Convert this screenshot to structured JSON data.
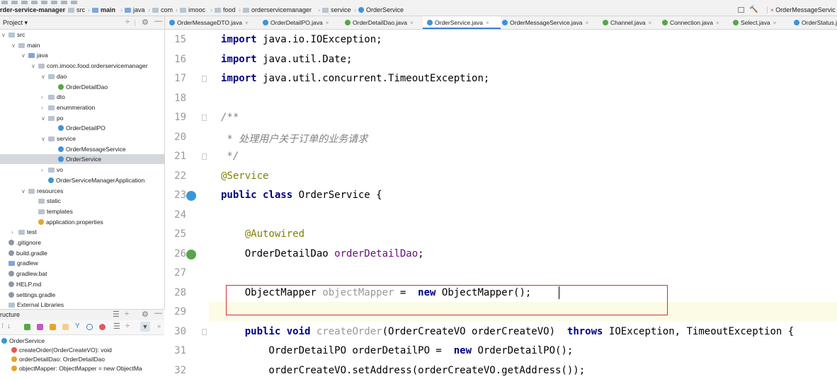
{
  "breadcrumb": [
    "rder-service-manager",
    "src",
    "main",
    "java",
    "com",
    "imooc",
    "food",
    "orderservicemanager",
    "service",
    "OrderService"
  ],
  "right_tab": "OrderMessageServic",
  "project_panel": {
    "title": "Project"
  },
  "tabs": [
    {
      "label": "OrderMessageDTO.java",
      "color": "#3d94d6"
    },
    {
      "label": "OrderDetailPO.java",
      "color": "#3d94d6"
    },
    {
      "label": "OrderDetailDao.java",
      "color": "#57a64a"
    },
    {
      "label": "OrderService.java",
      "color": "#3d94d6",
      "active": true
    },
    {
      "label": "OrderMessageService.java",
      "color": "#3d94d6"
    },
    {
      "label": "Channel.java",
      "color": "#57a64a"
    },
    {
      "label": "Connection.java",
      "color": "#57a64a"
    },
    {
      "label": "Select.java",
      "color": "#57a64a"
    },
    {
      "label": "OrderStatus.ja",
      "color": "#3d94d6"
    }
  ],
  "tree": [
    {
      "label": "src",
      "indent": 0,
      "chev": "v",
      "icon": "folder"
    },
    {
      "label": "main",
      "indent": 1,
      "chev": "v",
      "icon": "folder"
    },
    {
      "label": "java",
      "indent": 2,
      "chev": "v",
      "icon": "folder-blue"
    },
    {
      "label": "com.imooc.food.orderservicemanager",
      "indent": 3,
      "chev": "v",
      "icon": "folder"
    },
    {
      "label": "dao",
      "indent": 4,
      "chev": "v",
      "icon": "folder"
    },
    {
      "label": "OrderDetailDao",
      "indent": 5,
      "chev": "",
      "icon": "interface"
    },
    {
      "label": "dto",
      "indent": 4,
      "chev": ">",
      "icon": "folder"
    },
    {
      "label": "enummeration",
      "indent": 4,
      "chev": ">",
      "icon": "folder"
    },
    {
      "label": "po",
      "indent": 4,
      "chev": "v",
      "icon": "folder"
    },
    {
      "label": "OrderDetailPO",
      "indent": 5,
      "chev": "",
      "icon": "class"
    },
    {
      "label": "service",
      "indent": 4,
      "chev": "v",
      "icon": "folder"
    },
    {
      "label": "OrderMessageService",
      "indent": 5,
      "chev": "",
      "icon": "class"
    },
    {
      "label": "OrderService",
      "indent": 5,
      "chev": "",
      "icon": "class",
      "selected": true
    },
    {
      "label": "vo",
      "indent": 4,
      "chev": ">",
      "icon": "folder"
    },
    {
      "label": "OrderServiceManagerApplication",
      "indent": 4,
      "chev": "",
      "icon": "class"
    },
    {
      "label": "resources",
      "indent": 2,
      "chev": "v",
      "icon": "folder"
    },
    {
      "label": "static",
      "indent": 3,
      "chev": "",
      "icon": "folder"
    },
    {
      "label": "templates",
      "indent": 3,
      "chev": "",
      "icon": "folder"
    },
    {
      "label": "application.properties",
      "indent": 3,
      "chev": "",
      "icon": "props"
    },
    {
      "label": "test",
      "indent": 1,
      "chev": ">",
      "icon": "folder"
    },
    {
      "label": ".gitignore",
      "indent": 0,
      "chev": "",
      "icon": "file"
    },
    {
      "label": "build.gradle",
      "indent": 0,
      "chev": "",
      "icon": "file"
    },
    {
      "label": "gradlew",
      "indent": 0,
      "chev": "",
      "icon": "file-blue"
    },
    {
      "label": "gradlew.bat",
      "indent": 0,
      "chev": "",
      "icon": "file"
    },
    {
      "label": "HELP.md",
      "indent": 0,
      "chev": "",
      "icon": "file"
    },
    {
      "label": "settings.gradle",
      "indent": 0,
      "chev": "",
      "icon": "file"
    },
    {
      "label": "External Libraries",
      "indent": 0,
      "chev": "",
      "icon": "folder"
    }
  ],
  "structure": {
    "title": "ructure",
    "items": [
      {
        "label": "OrderService",
        "icon": "class",
        "indent": 0
      },
      {
        "label": "createOrder(OrderCreateVO): void",
        "icon": "method",
        "indent": 1
      },
      {
        "label": "orderDetailDao: OrderDetailDao",
        "icon": "field",
        "indent": 1
      },
      {
        "label": "objectMapper: ObjectMapper = new ObjectMa",
        "icon": "field",
        "indent": 1
      }
    ]
  },
  "editor": {
    "lines": [
      {
        "n": "15",
        "code": [
          [
            "kw",
            "import"
          ],
          [
            "",
            "java.io.IOException;"
          ]
        ]
      },
      {
        "n": "16",
        "code": [
          [
            "kw",
            "import"
          ],
          [
            "",
            "java.util.Date;"
          ]
        ]
      },
      {
        "n": "17",
        "code": [
          [
            "kw",
            "import"
          ],
          [
            "",
            "java.util.concurrent.TimeoutException;"
          ]
        ]
      },
      {
        "n": "18",
        "code": []
      },
      {
        "n": "19",
        "code": [
          [
            "cm",
            "/**"
          ]
        ]
      },
      {
        "n": "20",
        "code": [
          [
            "cm",
            " * 处理用户关于订单的业务请求"
          ]
        ]
      },
      {
        "n": "21",
        "code": [
          [
            "cm",
            " */"
          ]
        ]
      },
      {
        "n": "22",
        "code": [
          [
            "an",
            "@Service"
          ]
        ]
      },
      {
        "n": "23",
        "code": [
          [
            "kw",
            "public class"
          ],
          [
            "",
            " OrderService {"
          ]
        ]
      },
      {
        "n": "24",
        "code": []
      },
      {
        "n": "25",
        "code": [
          [
            "an",
            "    @Autowired"
          ]
        ]
      },
      {
        "n": "26",
        "code": [
          [
            "",
            "    OrderDetailDao "
          ],
          [
            "fld",
            "orderDetailDao"
          ],
          [
            "",
            ";"
          ]
        ]
      },
      {
        "n": "27",
        "code": []
      },
      {
        "n": "28",
        "code": [
          [
            "",
            "    ObjectMapper "
          ],
          [
            "un",
            "objectMapper"
          ],
          [
            "",
            " = "
          ],
          [
            "kw",
            "new"
          ],
          [
            "",
            " ObjectMapper();"
          ]
        ]
      },
      {
        "n": "29",
        "code": []
      },
      {
        "n": "30",
        "code": [
          [
            "kw",
            "    public void"
          ],
          [
            "un",
            " createOrder"
          ],
          [
            "",
            "(OrderCreateVO orderCreateVO) "
          ],
          [
            "kw",
            "throws"
          ],
          [
            "",
            " IOException, TimeoutException {"
          ]
        ]
      },
      {
        "n": "31",
        "code": [
          [
            "",
            "        OrderDetailPO orderDetailPO = "
          ],
          [
            "kw",
            "new"
          ],
          [
            "",
            " OrderDetailPO();"
          ]
        ]
      },
      {
        "n": "32",
        "code": [
          [
            "",
            "        orderCreateVO.setAddress(orderCreateVO.getAddress());"
          ]
        ]
      }
    ]
  }
}
